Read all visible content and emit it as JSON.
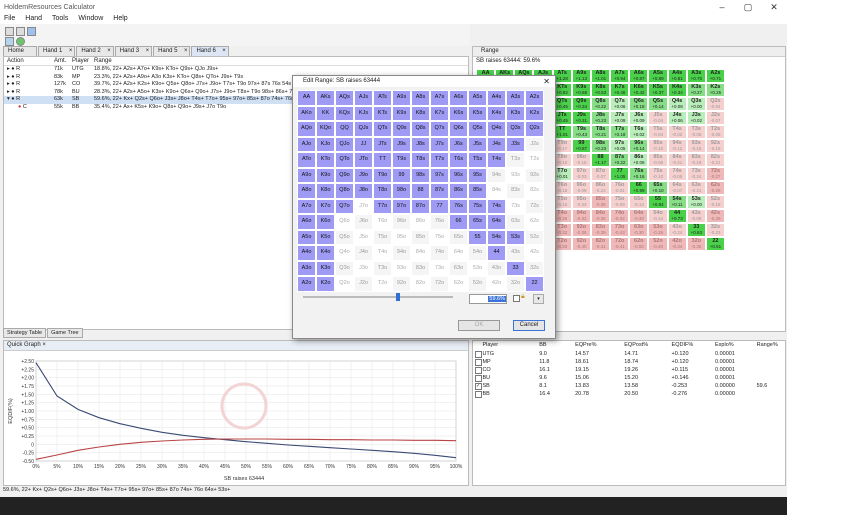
{
  "app": {
    "title": "HoldemResources Calculator",
    "window_controls": [
      "–",
      "▢",
      "✕"
    ]
  },
  "menu": [
    "File",
    "Hand",
    "Tools",
    "Window",
    "Help"
  ],
  "tabs": [
    {
      "label": "Home"
    },
    {
      "label": "Hand 1"
    },
    {
      "label": "Hand 2"
    },
    {
      "label": "Hand 3"
    },
    {
      "label": "Hand 5"
    },
    {
      "label": "Hand 6",
      "active": true
    }
  ],
  "strategy_table": {
    "headers": [
      "Action",
      "Amt.",
      "Player",
      "Range"
    ],
    "rows": [
      {
        "action": "R",
        "amt": "71k",
        "player": "UTG",
        "range": "18.8%, 22+ A2s+ A7o+ K9s+ KTo+ Q9s+ QJo J9s+"
      },
      {
        "action": "R",
        "amt": "83k",
        "player": "MP",
        "range": "23.3%, 22+ A2s+ A9o+ A3o K3s+ KTo+ Q8s+ QTo+ J9s+ T9s"
      },
      {
        "action": "R",
        "amt": "127k",
        "player": "CO",
        "range": "39.7%, 22+ A2s+ K2s+ K9o+ Q5s+ Q8o+ J7s+ J9o+ T7s+ T9o 97s+ 87s 76s 54s"
      },
      {
        "action": "R",
        "amt": "78k",
        "player": "BU",
        "range": "28.3%, 22+ A2s+ A5o+ K3s+ K9o+ Q6s+ Q9o+ J7s+ J9o+ T8s+ T9o 98s+ 86s+ 76s 65s"
      },
      {
        "action": "R",
        "amt": "63k",
        "player": "SB",
        "range": "59.6%, 22+ Kx+ Q2s+ Q6o+ J3s+ J8o+ T4s+ T7o+ 95s+ 97o+ 85s+ 87o 74s+ 76o 64s+",
        "selected": true
      },
      {
        "action": "C",
        "amt": "55k",
        "player": "BB",
        "range": "35.4%, 22+ Ax+ K5s+ K9o+ Q8s+ Q9o+ J9s+ J7o T9o"
      }
    ]
  },
  "bottom_tabs": [
    "Strategy Table",
    "Game Tree"
  ],
  "quick_graph": {
    "title": "Quick Graph",
    "xlabel": "SB raises 63444",
    "ylabel": "EQDIF(%)"
  },
  "chart_data": {
    "type": "line",
    "x": [
      0,
      5,
      10,
      15,
      20,
      25,
      30,
      35,
      40,
      45,
      50,
      55,
      60,
      65,
      70,
      75,
      80,
      85,
      90,
      95,
      100
    ],
    "x_tick_labels": [
      "0%",
      "5%",
      "10%",
      "15%",
      "20%",
      "25%",
      "30%",
      "35%",
      "40%",
      "45%",
      "50%",
      "55%",
      "60%",
      "65%",
      "70%",
      "75%",
      "80%",
      "85%",
      "90%",
      "95%",
      "100%"
    ],
    "y_tick_labels": [
      "+2.50",
      "+2.25",
      "+2.00",
      "+1.75",
      "+1.50",
      "+1.25",
      "+1.00",
      "+0.75",
      "+0.50",
      "+0.25",
      "0",
      "-0.25",
      "-0.50"
    ],
    "ylim": [
      -0.5,
      2.5
    ],
    "series": [
      {
        "color": "#3b4a73",
        "values": [
          2.45,
          1.45,
          1.05,
          0.8,
          0.62,
          0.48,
          0.36,
          0.27,
          0.2,
          0.14,
          0.08,
          0.03,
          -0.02,
          -0.06,
          -0.1,
          -0.14,
          -0.18,
          -0.22,
          -0.27,
          -0.33,
          -0.4
        ]
      },
      {
        "color": "#b84444",
        "values": [
          -0.45,
          -0.32,
          -0.18,
          -0.08,
          0.0,
          0.06,
          0.1,
          0.13,
          0.15,
          0.16,
          0.16,
          0.16,
          0.15,
          0.15,
          0.14,
          0.14,
          0.13,
          0.13,
          0.12,
          0.12,
          0.11
        ]
      }
    ]
  },
  "status_text": "59.6%, 22+ Kx+ Q2s+ Q6o+ J3s+ J8o+ T4s+ T7o+ 95s+ 97o+ 85s+ 87o 74s+ 76o 64s+ 53s+",
  "range_panel": {
    "title": "Range",
    "subtitle": "SB raises 63444: 59.6%",
    "row0": [
      {
        "h": "AA",
        "v": ""
      },
      {
        "h": "AKs",
        "v": ""
      },
      {
        "h": "AQs",
        "v": ""
      },
      {
        "h": "AJs",
        "v": ""
      },
      {
        "h": "ATs",
        "v": "+1.28"
      },
      {
        "h": "A9s",
        "v": "+1.13"
      },
      {
        "h": "A8s",
        "v": "+1.01"
      },
      {
        "h": "A7s",
        "v": "+0.94"
      },
      {
        "h": "A6s",
        "v": "+0.87"
      },
      {
        "h": "A5s",
        "v": "+0.89"
      },
      {
        "h": "A4s",
        "v": "+0.81"
      },
      {
        "h": "A3s",
        "v": "+0.75"
      },
      {
        "h": "A2s",
        "v": "+0.71"
      }
    ],
    "row1": [
      {
        "h": "KTs",
        "v": "+0.82"
      },
      {
        "h": "K9s",
        "v": "+0.68"
      },
      {
        "h": "K8s",
        "v": "+0.53"
      },
      {
        "h": "K7s",
        "v": "+0.46"
      },
      {
        "h": "K6s",
        "v": "+0.42"
      },
      {
        "h": "K5s",
        "v": "+0.37"
      },
      {
        "h": "K4s",
        "v": "+0.34"
      },
      {
        "h": "K3s",
        "v": "+0.27"
      },
      {
        "h": "K2s",
        "v": "+0.25"
      }
    ],
    "row2": [
      {
        "h": "QTs",
        "v": "+0.45"
      },
      {
        "h": "Q9s",
        "v": "+0.34"
      },
      {
        "h": "Q8s",
        "v": "+0.22"
      },
      {
        "h": "Q7s",
        "v": "+0.06"
      },
      {
        "h": "Q6s",
        "v": "+0.18"
      },
      {
        "h": "Q5s",
        "v": "+0.14"
      },
      {
        "h": "Q4s",
        "v": "+0.08"
      },
      {
        "h": "Q3s",
        "v": "+0.00"
      },
      {
        "h": "Q2s",
        "v": "-0.04"
      }
    ],
    "row3": [
      {
        "h": "JTs",
        "v": "+0.45"
      },
      {
        "h": "J9s",
        "v": "+0.31"
      },
      {
        "h": "J8s",
        "v": "+0.23"
      },
      {
        "h": "J7s",
        "v": "+0.09"
      },
      {
        "h": "J6s",
        "v": "+0.09"
      },
      {
        "h": "J5s",
        "v": "-0.04"
      },
      {
        "h": "J4s",
        "v": "+0.06"
      },
      {
        "h": "J3s",
        "v": "+0.02"
      },
      {
        "h": "J2s",
        "v": "-0.07"
      }
    ],
    "other_rows": [
      [
        "TT",
        "T9s",
        "T8s",
        "T7s",
        "T6s",
        "T5s",
        "T4s",
        "T3s",
        "T2s"
      ],
      [
        "T9o",
        "99",
        "98s",
        "97s",
        "96s",
        "95s",
        "94s",
        "93s",
        "92s"
      ],
      [
        "T8o",
        "98o",
        "88",
        "87s",
        "86s",
        "85s",
        "84s",
        "83s",
        "82s"
      ],
      [
        "T7o",
        "97o",
        "87o",
        "77",
        "76s",
        "75s",
        "74s",
        "73s",
        "72s"
      ],
      [
        "T6o",
        "96o",
        "86o",
        "76o",
        "66",
        "65s",
        "64s",
        "63s",
        "62s"
      ],
      [
        "T5o",
        "95o",
        "85o",
        "75o",
        "65o",
        "55",
        "54s",
        "53s",
        "52s"
      ],
      [
        "T4o",
        "94o",
        "84o",
        "74o",
        "64o",
        "54o",
        "44",
        "43s",
        "42s"
      ],
      [
        "T3o",
        "93o",
        "83o",
        "73o",
        "63o",
        "53o",
        "43o",
        "33",
        "32s"
      ],
      [
        "T2o",
        "92o",
        "82o",
        "72o",
        "62o",
        "52o",
        "42o",
        "32o",
        "22"
      ]
    ],
    "other_values": [
      [
        "+1.01",
        "+0.43",
        "+0.21",
        "+0.18",
        "+0.02",
        "-0.04",
        "-0.02",
        "-0.05",
        "-0.05"
      ],
      [
        "-0.17",
        "+0.87",
        "+0.23",
        "+0.05",
        "+0.14",
        "-0.10",
        "-0.12",
        "-0.15",
        "-0.15"
      ],
      [
        "-0.10",
        "-0.16",
        "+1.17",
        "+0.22",
        "+0.08",
        "-0.06",
        "-0.21",
        "-0.18",
        "-0.21"
      ],
      [
        "+0.01",
        "-0.03",
        "-0.07",
        "+1.05",
        "+0.16",
        "-0.10",
        "-0.08",
        "-0.24",
        "-0.27"
      ],
      [
        "-0.18",
        "-0.08",
        "-0.24",
        "-0.01",
        "+0.99",
        "+0.10",
        "-0.07",
        "-0.21",
        "-0.26"
      ],
      [
        "-0.15",
        "-0.23",
        "-0.36",
        "-0.09",
        "-0.14",
        "+0.84",
        "+0.11",
        "+0.00",
        "-0.18"
      ],
      [
        "-0.26",
        "-0.32",
        "-0.36",
        "-0.32",
        "-0.30",
        "-0.14",
        "+0.73",
        "-0.09",
        "-0.29"
      ],
      [
        "-0.32",
        "-0.36",
        "-0.39",
        "-0.43",
        "-0.30",
        "-0.26",
        "-0.24",
        "+0.63",
        "-0.23"
      ],
      [
        "-0.33",
        "-0.40",
        "-0.41",
        "-0.41",
        "-0.50",
        "-0.40",
        "-0.34",
        "-0.35",
        "+0.51"
      ]
    ]
  },
  "equity_table": {
    "headers": [
      "Player",
      "BB",
      "EQPre%",
      "EQPost%",
      "EQDIF%",
      "Explo%",
      "Range%"
    ],
    "rows": [
      {
        "player": "UTG",
        "bb": "9.0",
        "pre": "14.57",
        "post": "14.71",
        "dif": "+0.120",
        "explo": "0.00001",
        "range": "",
        "checked": false
      },
      {
        "player": "MP",
        "bb": "11.8",
        "pre": "18.61",
        "post": "18.74",
        "dif": "+0.120",
        "explo": "0.00001",
        "range": "",
        "checked": false
      },
      {
        "player": "CO",
        "bb": "16.1",
        "pre": "19.15",
        "post": "19.26",
        "dif": "+0.115",
        "explo": "0.00001",
        "range": "",
        "checked": false
      },
      {
        "player": "BU",
        "bb": "9.6",
        "pre": "15.06",
        "post": "15.20",
        "dif": "+0.146",
        "explo": "0.00001",
        "range": "",
        "checked": false
      },
      {
        "player": "SB",
        "bb": "8.1",
        "pre": "13.83",
        "post": "13.58",
        "dif": "-0.253",
        "explo": "0.00000",
        "range": "59.6",
        "checked": true
      },
      {
        "player": "BB",
        "bb": "16.4",
        "pre": "20.78",
        "post": "20.50",
        "dif": "-0.276",
        "explo": "0.00000",
        "range": "",
        "checked": false
      }
    ]
  },
  "dialog": {
    "title": "Edit Range: SB raises 63444",
    "close": "✕",
    "percent_value": "59.6%",
    "ok_label": "OK",
    "cancel_label": "Cancel",
    "grid": [
      [
        "AA",
        "AKs",
        "AQs",
        "AJs",
        "ATs",
        "A9s",
        "A8s",
        "A7s",
        "A6s",
        "A5s",
        "A4s",
        "A3s",
        "A2s"
      ],
      [
        "AKo",
        "KK",
        "KQs",
        "KJs",
        "KTs",
        "K9s",
        "K8s",
        "K7s",
        "K6s",
        "K5s",
        "K4s",
        "K3s",
        "K2s"
      ],
      [
        "AQo",
        "KQo",
        "QQ",
        "QJs",
        "QTs",
        "Q9s",
        "Q8s",
        "Q7s",
        "Q6s",
        "Q5s",
        "Q4s",
        "Q3s",
        "Q2s"
      ],
      [
        "AJo",
        "KJo",
        "QJo",
        "JJ",
        "JTs",
        "J9s",
        "J8s",
        "J7s",
        "J6s",
        "J5s",
        "J4s",
        "J3s",
        "J2s"
      ],
      [
        "ATo",
        "KTo",
        "QTo",
        "JTo",
        "TT",
        "T9s",
        "T8s",
        "T7s",
        "T6s",
        "T5s",
        "T4s",
        "T3s",
        "T2s"
      ],
      [
        "A9o",
        "K9o",
        "Q9o",
        "J9o",
        "T9o",
        "99",
        "98s",
        "97s",
        "96s",
        "95s",
        "94s",
        "93s",
        "92s"
      ],
      [
        "A8o",
        "K8o",
        "Q8o",
        "J8o",
        "T8o",
        "98o",
        "88",
        "87s",
        "86s",
        "85s",
        "84s",
        "83s",
        "82s"
      ],
      [
        "A7o",
        "K7o",
        "Q7o",
        "J7o",
        "T7o",
        "97o",
        "87o",
        "77",
        "76s",
        "75s",
        "74s",
        "73s",
        "72s"
      ],
      [
        "A6o",
        "K6o",
        "Q6o",
        "J6o",
        "T6o",
        "96o",
        "86o",
        "76o",
        "66",
        "65s",
        "64s",
        "63s",
        "62s"
      ],
      [
        "A5o",
        "K5o",
        "Q5o",
        "J5o",
        "T5o",
        "95o",
        "85o",
        "75o",
        "65o",
        "55",
        "54s",
        "53s",
        "52s"
      ],
      [
        "A4o",
        "K4o",
        "Q4o",
        "J4o",
        "T4o",
        "94o",
        "84o",
        "74o",
        "64o",
        "54o",
        "44",
        "43s",
        "42s"
      ],
      [
        "A3o",
        "K3o",
        "Q3o",
        "J3o",
        "T3o",
        "93o",
        "83o",
        "73o",
        "63o",
        "53o",
        "43o",
        "33",
        "32s"
      ],
      [
        "A2o",
        "K2o",
        "Q2o",
        "J2o",
        "T2o",
        "92o",
        "82o",
        "72o",
        "62o",
        "52o",
        "42o",
        "32o",
        "22"
      ]
    ],
    "selected": [
      [
        1,
        1,
        1,
        1,
        1,
        1,
        1,
        1,
        1,
        1,
        1,
        1,
        1
      ],
      [
        1,
        1,
        1,
        1,
        1,
        1,
        1,
        1,
        1,
        1,
        1,
        1,
        1
      ],
      [
        1,
        1,
        1,
        1,
        1,
        1,
        1,
        1,
        1,
        1,
        1,
        1,
        1
      ],
      [
        1,
        1,
        1,
        1,
        1,
        1,
        1,
        1,
        1,
        1,
        1,
        1,
        0
      ],
      [
        1,
        1,
        1,
        1,
        1,
        1,
        1,
        1,
        1,
        1,
        1,
        0,
        0
      ],
      [
        1,
        1,
        1,
        1,
        1,
        1,
        1,
        1,
        1,
        1,
        0,
        0,
        0
      ],
      [
        1,
        1,
        1,
        1,
        1,
        1,
        1,
        1,
        1,
        1,
        0,
        0,
        0
      ],
      [
        1,
        1,
        1,
        0,
        1,
        1,
        1,
        1,
        1,
        1,
        1,
        0,
        0
      ],
      [
        1,
        1,
        0,
        0,
        0,
        0,
        0,
        0,
        1,
        1,
        1,
        0,
        0
      ],
      [
        1,
        1,
        0,
        0,
        0,
        0,
        0,
        0,
        0,
        1,
        1,
        1,
        0
      ],
      [
        1,
        1,
        0,
        0,
        0,
        0,
        0,
        0,
        0,
        0,
        1,
        0,
        0
      ],
      [
        1,
        1,
        0,
        0,
        0,
        0,
        0,
        0,
        0,
        0,
        0,
        1,
        0
      ],
      [
        1,
        1,
        0,
        0,
        0,
        0,
        0,
        0,
        0,
        0,
        0,
        0,
        1
      ]
    ]
  }
}
